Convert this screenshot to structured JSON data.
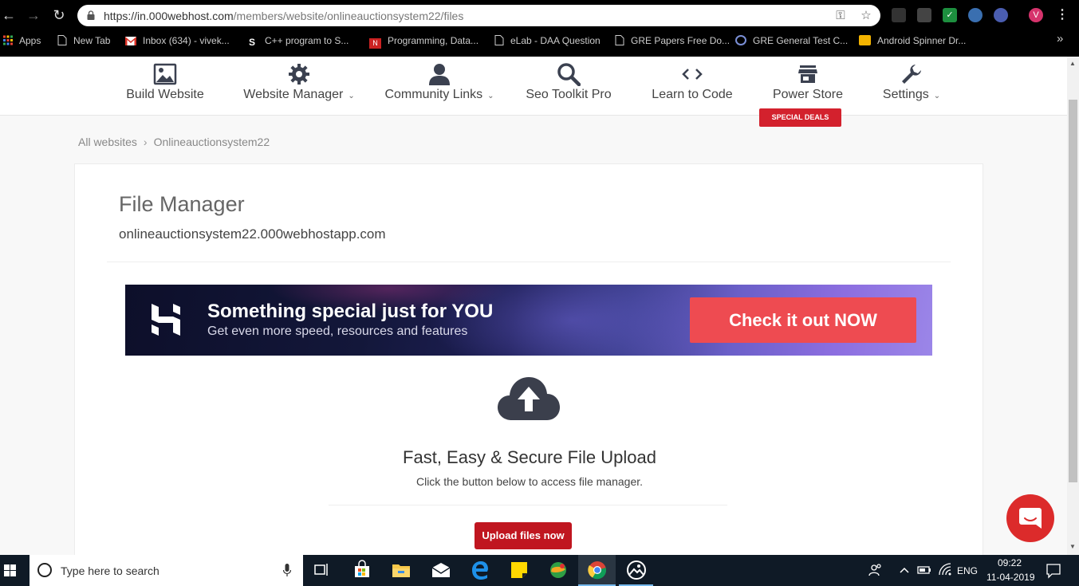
{
  "browser": {
    "url_main": "https://in.000webhost.com",
    "url_path": "/members/website/onlineauctionsystem22/files",
    "profile_initial": "V",
    "bookmarks": [
      "Apps",
      "New Tab",
      "Inbox (634) - vivek...",
      "C++ program to S...",
      "Programming, Data...",
      "eLab - DAA Question",
      "GRE Papers Free Do...",
      "GRE General Test C...",
      "Android Spinner Dr..."
    ],
    "more_bookmarks": "»"
  },
  "nav": {
    "items": [
      {
        "label": "Build Website",
        "icon": "image-icon",
        "caret": false
      },
      {
        "label": "Website Manager",
        "icon": "gear-icon",
        "caret": true
      },
      {
        "label": "Community Links",
        "icon": "person-icon",
        "caret": true
      },
      {
        "label": "Seo Toolkit Pro",
        "icon": "search-icon",
        "caret": false
      },
      {
        "label": "Learn to Code",
        "icon": "code-icon",
        "caret": false
      },
      {
        "label": "Power Store",
        "icon": "store-icon",
        "caret": false
      },
      {
        "label": "Settings",
        "icon": "wrench-icon",
        "caret": true
      }
    ],
    "special_badge": "SPECIAL DEALS",
    "caret_glyph": "⌄"
  },
  "breadcrumb": {
    "root": "All websites",
    "separator": "›",
    "current": "Onlineauctionsystem22"
  },
  "file_manager": {
    "title": "File Manager",
    "domain": "onlineauctionsystem22.000webhostapp.com"
  },
  "banner": {
    "headline": "Something special just for YOU",
    "subline": "Get even more speed, resources and features",
    "cta": "Check it out NOW"
  },
  "upload": {
    "title": "Fast, Easy & Secure File Upload",
    "subtitle": "Click the button below to access file manager.",
    "button": "Upload files now"
  },
  "taskbar": {
    "search_placeholder": "Type here to search",
    "language": "ENG",
    "time": "09:22",
    "date": "11-04-2019"
  },
  "colors": {
    "brand_red": "#c01620",
    "badge_red": "#d3212d",
    "cta_red": "#ee4b51",
    "chat_red": "#dc2b2b"
  }
}
